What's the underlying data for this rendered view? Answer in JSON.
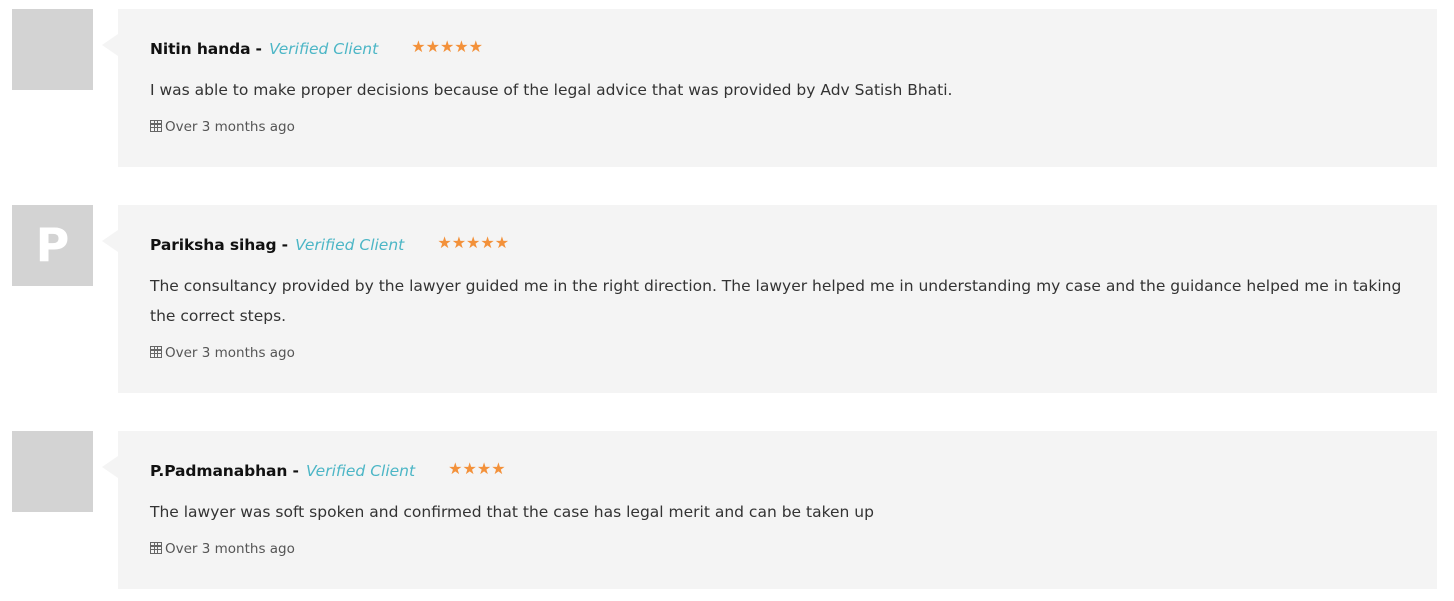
{
  "reviews": [
    {
      "avatar_letter": "",
      "name": "Nitin handa",
      "separator": "-",
      "badge": "Verified Client",
      "rating": 5,
      "stars_text": "★★★★★",
      "text": "I was able to make proper decisions because of the legal advice that was provided by Adv Satish Bhati.",
      "date": "Over 3 months ago"
    },
    {
      "avatar_letter": "P",
      "name": "Pariksha sihag",
      "separator": "-",
      "badge": "Verified Client",
      "rating": 5,
      "stars_text": "★★★★★",
      "text": "The consultancy provided by the lawyer guided me in the right direction. The lawyer helped me in understanding my case and the guidance helped me in taking the correct steps.",
      "date": "Over 3 months ago"
    },
    {
      "avatar_letter": "",
      "name": "P.Padmanabhan",
      "separator": "-",
      "badge": "Verified Client",
      "rating": 4,
      "stars_text": "★★★★",
      "text": "The lawyer was soft spoken and confirmed that the case has legal merit and can be taken up",
      "date": "Over 3 months ago"
    }
  ],
  "colors": {
    "star": "#f3913a",
    "verified": "#4cb6c6",
    "card_bg": "#f4f4f4",
    "avatar_bg": "#d3d3d3"
  },
  "icons": {
    "star": "star-icon",
    "date": "calendar-icon"
  }
}
